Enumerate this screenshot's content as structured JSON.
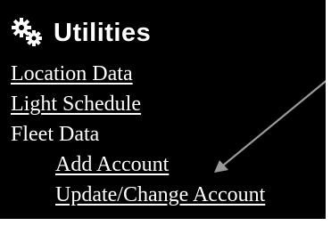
{
  "header": {
    "title": "Utilities",
    "icon": "gears-icon"
  },
  "menu": {
    "items": [
      {
        "label": "Location Data"
      },
      {
        "label": "Light Schedule"
      },
      {
        "label": "Fleet Data"
      }
    ],
    "subitems": [
      {
        "label": "Add Account"
      },
      {
        "label": "Update/Change Account"
      }
    ]
  },
  "colors": {
    "background": "#000000",
    "text": "#ffffff",
    "arrow": "#9a9a9a"
  }
}
